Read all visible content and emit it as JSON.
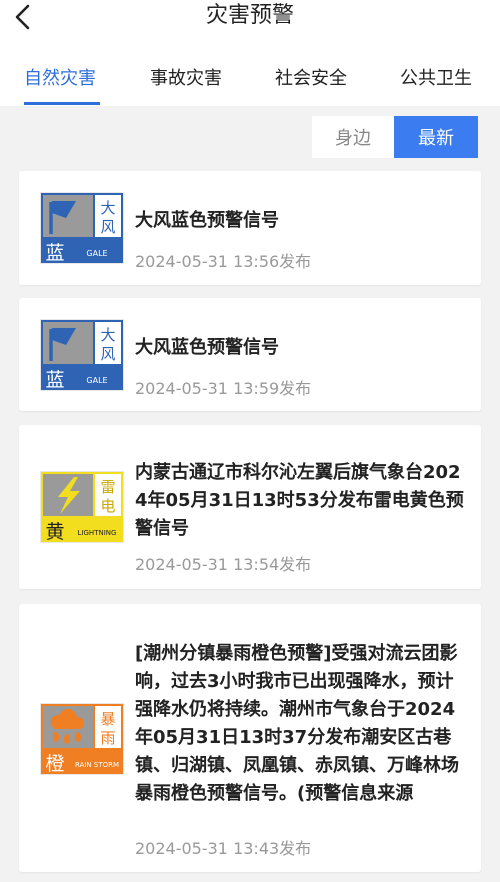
{
  "header": {
    "title": "灾害预警"
  },
  "tabs": [
    {
      "label": "自然灾害"
    },
    {
      "label": "事故灾害"
    },
    {
      "label": "社会安全"
    },
    {
      "label": "公共卫生"
    }
  ],
  "switch": {
    "nearby": "身边",
    "latest": "最新"
  },
  "colors": {
    "accent": "#2e6fd9",
    "blue_warning": "#2f64b5",
    "yellow_warning": "#f2de1f",
    "orange_warning": "#f07f24"
  },
  "cards": [
    {
      "badge": {
        "icon": "wind-flag-icon",
        "level": "蓝",
        "type": "大风",
        "type_line1": "大",
        "type_line2": "风",
        "en": "GALE"
      },
      "title": "大风蓝色预警信号",
      "time": "2024-05-31 13:56发布"
    },
    {
      "badge": {
        "icon": "wind-flag-icon",
        "level": "蓝",
        "type": "大风",
        "type_line1": "大",
        "type_line2": "风",
        "en": "GALE"
      },
      "title": "大风蓝色预警信号",
      "time": "2024-05-31 13:59发布"
    },
    {
      "badge": {
        "icon": "lightning-icon",
        "level": "黄",
        "type": "雷电",
        "type_line1": "雷",
        "type_line2": "电",
        "en": "LIGHTNING"
      },
      "title": "内蒙古通辽市科尔沁左翼后旗气象台2024年05月31日13时53分发布雷电黄色预警信号",
      "time": "2024-05-31 13:54发布"
    },
    {
      "badge": {
        "icon": "rain-cloud-icon",
        "level": "橙",
        "type": "暴雨",
        "type_line1": "暴",
        "type_line2": "雨",
        "en": "RAIN STORM"
      },
      "title": "[潮州分镇暴雨橙色预警]受强对流云团影响，过去3小时我市已出现强降水，预计强降水仍将持续。潮州市气象台于2024年05月31日13时37分发布潮安区古巷镇、归湖镇、凤凰镇、赤凤镇、万峰林场暴雨橙色预警信号。(预警信息来源",
      "time": "2024-05-31 13:43发布"
    }
  ]
}
